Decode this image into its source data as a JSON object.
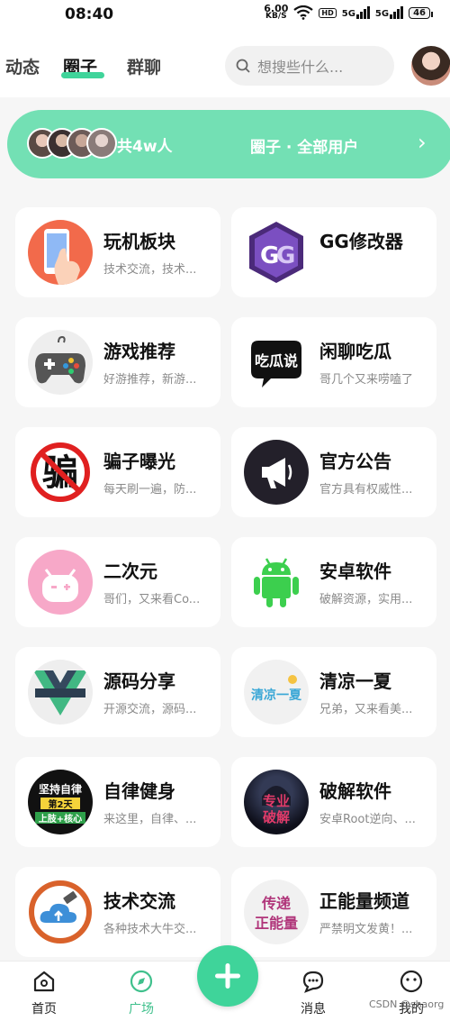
{
  "status_bar": {
    "time": "08:40",
    "net_speed_value": "6.00",
    "net_speed_unit": "KB/S",
    "hd_label": "HD",
    "sim1": "5G",
    "sim2": "5G",
    "battery": "46"
  },
  "header": {
    "tabs": [
      {
        "label": "动态"
      },
      {
        "label": "圈子"
      },
      {
        "label": "群聊"
      }
    ],
    "active_tab": "圈子",
    "search_placeholder": "想搜些什么..."
  },
  "banner": {
    "count_label": "共4w人",
    "title": "圈子 · 全部用户",
    "chevron": "›"
  },
  "circles": [
    {
      "title": "玩机板块",
      "desc": "技术交流，技术...",
      "icon": "phone-hand-icon"
    },
    {
      "title": "GG修改器",
      "desc": "",
      "icon": "gg-logo-icon"
    },
    {
      "title": "游戏推荐",
      "desc": "好游推荐，新游...",
      "icon": "gamepad-icon"
    },
    {
      "title": "闲聊吃瓜",
      "desc": "哥几个又来唠嗑了",
      "icon": "chat-bubble-logo-icon",
      "icon_text": "吃瓜说"
    },
    {
      "title": "骗子曝光",
      "desc": "每天刷一遍，防...",
      "icon": "no-scam-icon",
      "icon_text": "骗"
    },
    {
      "title": "官方公告",
      "desc": "官方具有权威性...",
      "icon": "megaphone-icon"
    },
    {
      "title": "二次元",
      "desc": "哥们，又来看Co...",
      "icon": "anime-face-icon"
    },
    {
      "title": "安卓软件",
      "desc": "破解资源，实用...",
      "icon": "android-icon"
    },
    {
      "title": "源码分享",
      "desc": "开源交流，源码...",
      "icon": "vue-logo-icon"
    },
    {
      "title": "清凉一夏",
      "desc": "兄弟，又来看美...",
      "icon": "summer-text-icon",
      "icon_text": "清凉一夏"
    },
    {
      "title": "自律健身",
      "desc": "来这里，自律、...",
      "icon": "fitness-badge-icon",
      "icon_text": [
        "坚持自律",
        "第2天",
        "上肢+核心"
      ]
    },
    {
      "title": "破解软件",
      "desc": "安卓Root逆向、...",
      "icon": "hacker-icon",
      "icon_text": [
        "专业",
        "破解"
      ]
    },
    {
      "title": "技术交流",
      "desc": "各种技术大牛交...",
      "icon": "cloud-usb-icon"
    },
    {
      "title": "正能量频道",
      "desc": "严禁明文发黄！...",
      "icon": "positive-energy-icon",
      "icon_text": [
        "传递",
        "正能量"
      ]
    }
  ],
  "bottom_nav": {
    "items": [
      {
        "label": "首页"
      },
      {
        "label": "广场"
      },
      {
        "label": "消息"
      },
      {
        "label": "我的"
      }
    ],
    "active": "广场"
  },
  "watermark": "CSDN @shaorg",
  "colors": {
    "accent": "#3fd49a",
    "banner": "#73e0b4",
    "background": "#f6f6f6"
  }
}
